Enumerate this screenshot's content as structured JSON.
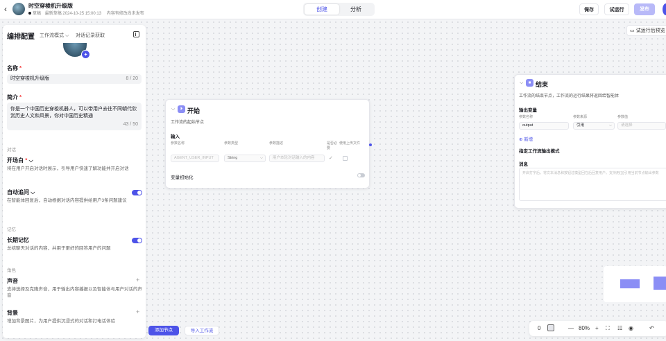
{
  "header": {
    "back_icon": "chevron-left-icon",
    "title": "时空穿梭机升级版",
    "status": "草稿",
    "saved_info": "最新草稿 2024-10-25 15:00:13",
    "publish_note": "内容有修改尚未发布",
    "tabs": [
      "创建",
      "分析"
    ],
    "save": "保存",
    "test_run": "试运行",
    "publish": "发布"
  },
  "left": {
    "title": "编排配置",
    "mode": "工作流模式",
    "record": "对话记录获取",
    "name_label": "名称",
    "name_value": "时空穿梭机升级版",
    "name_count": "8 / 20",
    "intro_label": "简介",
    "intro_value": "你是一个中国历史穿梭机器人，可以带用户去往不同朝代欣赏历史人文和风景，你对中国历史精通",
    "intro_count": "43 / 50",
    "sec_dialog": "对话",
    "opening_title": "开场白",
    "opening_desc": "将在用户开启对话时展示，引导用户快速了解功能并开启对话",
    "followup_title": "自动追问",
    "followup_desc": "在智能体回复后，自动根据对话内容提供给用户3条问题建议",
    "sec_memory": "记忆",
    "ltm_title": "长期记忆",
    "ltm_desc": "总结聊天对话的内容，并用于更好的回答用户的问题",
    "sec_role": "角色",
    "voice_title": "声音",
    "voice_desc": "支持选择及克隆声音，用于输出内容播报以及智能体与用户对话的声音",
    "bg_title": "背景",
    "bg_desc": "增加背景图片，为用户提供沉浸式的对话和打电话体验"
  },
  "start_node": {
    "title": "开始",
    "desc": "工作流的起始节点",
    "input_label": "输入",
    "cols": [
      "参数名称",
      "参数类型",
      "参数描述",
      "是否必要",
      "使用上传文件"
    ],
    "param_name": "AGENT_USER_INPUT",
    "param_type": "String",
    "param_desc_placeholder": "用户本轮对话输入的内容",
    "var_init": "变量初始化"
  },
  "end_node": {
    "title": "结束",
    "desc": "工作流的结束节点，工作流的运行结果将返回给智能体",
    "output_label": "输出变量",
    "cols": [
      "参数名称",
      "参数来源",
      "参数值"
    ],
    "var_name": "output",
    "source": "引用",
    "value_placeholder": "请选择",
    "add": "新增",
    "output_mode": "指定工作流输出模式",
    "message_label": "消息",
    "message_placeholder": "开启打字后，将文本消息和按钮过模型回在后回复用户。支持用{{}}引用当前节点输出参数"
  },
  "canvas": {
    "after_test": "试运行后预览",
    "add_node": "添加节点",
    "import_flow": "导入工作流",
    "zoom": "80%",
    "zero": "0"
  }
}
